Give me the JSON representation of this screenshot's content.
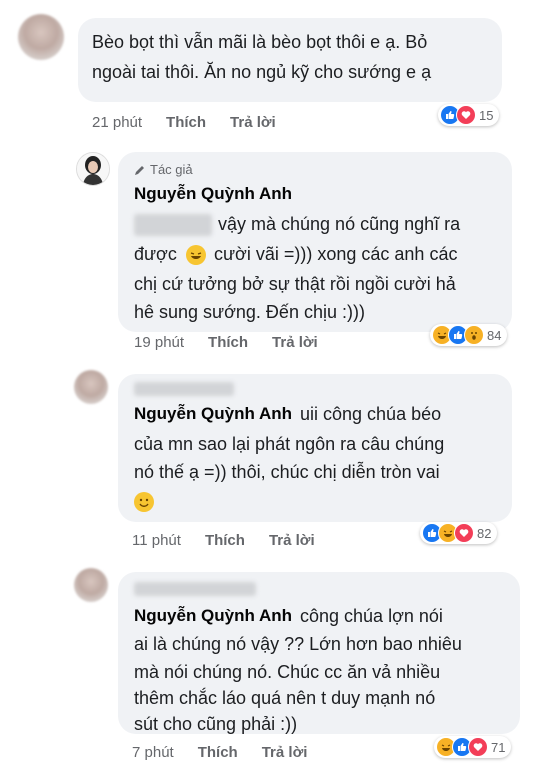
{
  "comments": [
    {
      "text_lines": [
        "Bèo bọt thì vẫn mãi là bèo bọt thôi e ạ. Bỏ",
        "ngoài tai thôi. Ăn no ngủ kỹ cho sướng e ạ"
      ],
      "time": "21 phút",
      "like": "Thích",
      "reply": "Trả lời",
      "reaction_count": "15"
    },
    {
      "author_tag": "Tác giả",
      "name": "Nguyễn Quỳnh Anh",
      "text_lines": [
        "vậy mà chúng nó cũng nghĩ ra",
        "được",
        "cười vãi =))) xong các anh các",
        "chị cứ tưởng bở sự thật rồi ngồi cười hả",
        "hê sung sướng. Đến chịu :)))"
      ],
      "time": "19 phút",
      "like": "Thích",
      "reply": "Trả lời",
      "reaction_count": "84"
    },
    {
      "name": "Nguyễn Quỳnh Anh",
      "text_lines": [
        "uii công chúa béo",
        "của mn sao lại phát ngôn ra câu chúng",
        "nó thế ạ =)) thôi, chúc chị diễn tròn vai"
      ],
      "time": "11 phút",
      "like": "Thích",
      "reply": "Trả lời",
      "reaction_count": "82"
    },
    {
      "name": "Nguyễn Quỳnh Anh",
      "text_lines": [
        "công chúa lợn nói",
        "ai là chúng nó vậy ?? Lớn hơn bao nhiêu",
        "mà nói chúng nó. Chúc cc ăn vả nhiều",
        "thêm chắc láo quá nên t duy mạnh nó",
        "sút cho cũng phải :))"
      ],
      "time": "7 phút",
      "like": "Thích",
      "reply": "Trả lời",
      "reaction_count": "71"
    }
  ],
  "colors": {
    "bubble": "#f0f2f5",
    "like": "#1877f2",
    "love": "#f33e58",
    "haha": "#f7b125",
    "meta": "#65676b"
  },
  "icons": [
    "like-icon",
    "love-icon",
    "haha-icon",
    "wow-icon",
    "pencil-icon",
    "rofl-emoji",
    "smile-emoji"
  ]
}
